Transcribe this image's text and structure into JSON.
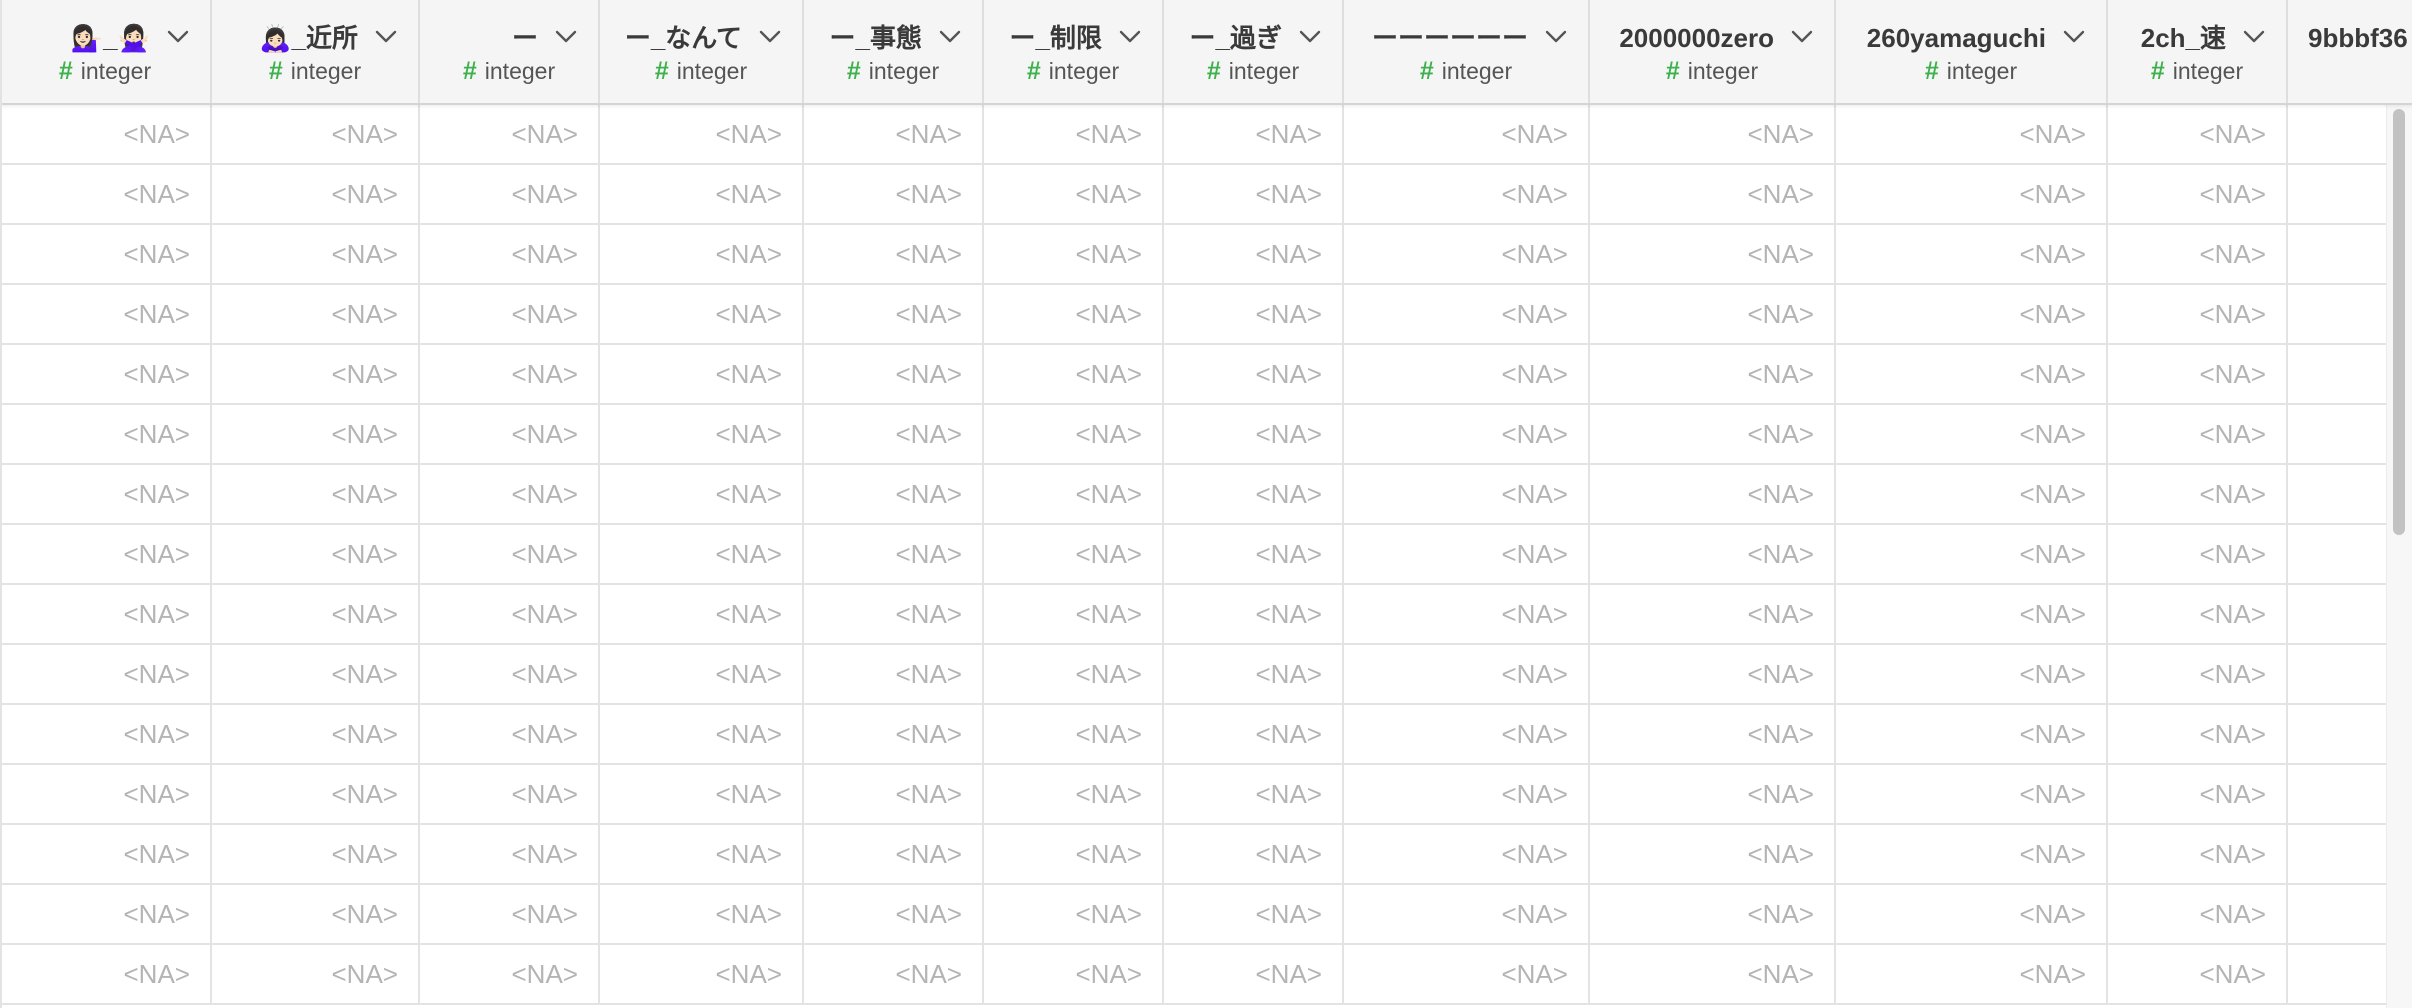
{
  "columns": [
    {
      "name": "💁🏻‍♀️_🙅🏻‍♀️",
      "type_icon": "#",
      "type": "integer"
    },
    {
      "name": "🙇🏻‍♀️_近所",
      "type_icon": "#",
      "type": "integer"
    },
    {
      "name": "ー",
      "type_icon": "#",
      "type": "integer"
    },
    {
      "name": "ー_なんて",
      "type_icon": "#",
      "type": "integer"
    },
    {
      "name": "ー_事態",
      "type_icon": "#",
      "type": "integer"
    },
    {
      "name": "ー_制限",
      "type_icon": "#",
      "type": "integer"
    },
    {
      "name": "ー_過ぎ",
      "type_icon": "#",
      "type": "integer"
    },
    {
      "name": "ーーーーーー",
      "type_icon": "#",
      "type": "integer"
    },
    {
      "name": "2000000zero",
      "type_icon": "#",
      "type": "integer"
    },
    {
      "name": "260yamaguchi",
      "type_icon": "#",
      "type": "integer"
    },
    {
      "name": "2ch_速",
      "type_icon": "#",
      "type": "integer"
    },
    {
      "name": "9bbbf36",
      "type_icon": "",
      "type": ""
    }
  ],
  "rows": [
    [
      "<NA>",
      "<NA>",
      "<NA>",
      "<NA>",
      "<NA>",
      "<NA>",
      "<NA>",
      "<NA>",
      "<NA>",
      "<NA>",
      "<NA>",
      ""
    ],
    [
      "<NA>",
      "<NA>",
      "<NA>",
      "<NA>",
      "<NA>",
      "<NA>",
      "<NA>",
      "<NA>",
      "<NA>",
      "<NA>",
      "<NA>",
      ""
    ],
    [
      "<NA>",
      "<NA>",
      "<NA>",
      "<NA>",
      "<NA>",
      "<NA>",
      "<NA>",
      "<NA>",
      "<NA>",
      "<NA>",
      "<NA>",
      ""
    ],
    [
      "<NA>",
      "<NA>",
      "<NA>",
      "<NA>",
      "<NA>",
      "<NA>",
      "<NA>",
      "<NA>",
      "<NA>",
      "<NA>",
      "<NA>",
      ""
    ],
    [
      "<NA>",
      "<NA>",
      "<NA>",
      "<NA>",
      "<NA>",
      "<NA>",
      "<NA>",
      "<NA>",
      "<NA>",
      "<NA>",
      "<NA>",
      ""
    ],
    [
      "<NA>",
      "<NA>",
      "<NA>",
      "<NA>",
      "<NA>",
      "<NA>",
      "<NA>",
      "<NA>",
      "<NA>",
      "<NA>",
      "<NA>",
      ""
    ],
    [
      "<NA>",
      "<NA>",
      "<NA>",
      "<NA>",
      "<NA>",
      "<NA>",
      "<NA>",
      "<NA>",
      "<NA>",
      "<NA>",
      "<NA>",
      ""
    ],
    [
      "<NA>",
      "<NA>",
      "<NA>",
      "<NA>",
      "<NA>",
      "<NA>",
      "<NA>",
      "<NA>",
      "<NA>",
      "<NA>",
      "<NA>",
      ""
    ],
    [
      "<NA>",
      "<NA>",
      "<NA>",
      "<NA>",
      "<NA>",
      "<NA>",
      "<NA>",
      "<NA>",
      "<NA>",
      "<NA>",
      "<NA>",
      ""
    ],
    [
      "<NA>",
      "<NA>",
      "<NA>",
      "<NA>",
      "<NA>",
      "<NA>",
      "<NA>",
      "<NA>",
      "<NA>",
      "<NA>",
      "<NA>",
      ""
    ],
    [
      "<NA>",
      "<NA>",
      "<NA>",
      "<NA>",
      "<NA>",
      "<NA>",
      "<NA>",
      "<NA>",
      "<NA>",
      "<NA>",
      "<NA>",
      ""
    ],
    [
      "<NA>",
      "<NA>",
      "<NA>",
      "<NA>",
      "<NA>",
      "<NA>",
      "<NA>",
      "<NA>",
      "<NA>",
      "<NA>",
      "<NA>",
      ""
    ],
    [
      "<NA>",
      "<NA>",
      "<NA>",
      "<NA>",
      "<NA>",
      "<NA>",
      "<NA>",
      "<NA>",
      "<NA>",
      "<NA>",
      "<NA>",
      ""
    ],
    [
      "<NA>",
      "<NA>",
      "<NA>",
      "<NA>",
      "<NA>",
      "<NA>",
      "<NA>",
      "<NA>",
      "<NA>",
      "<NA>",
      "<NA>",
      ""
    ],
    [
      "<NA>",
      "<NA>",
      "<NA>",
      "<NA>",
      "<NA>",
      "<NA>",
      "<NA>",
      "<NA>",
      "<NA>",
      "<NA>",
      "<NA>",
      ""
    ]
  ],
  "icons": {
    "column_menu": "chevron-down-icon",
    "type": "hash-icon"
  },
  "colors": {
    "type_icon": "#3db14b",
    "header_bg": "#f5f5f5",
    "null_text": "#b4b4b4",
    "grid_line": "#e3e3e3"
  }
}
